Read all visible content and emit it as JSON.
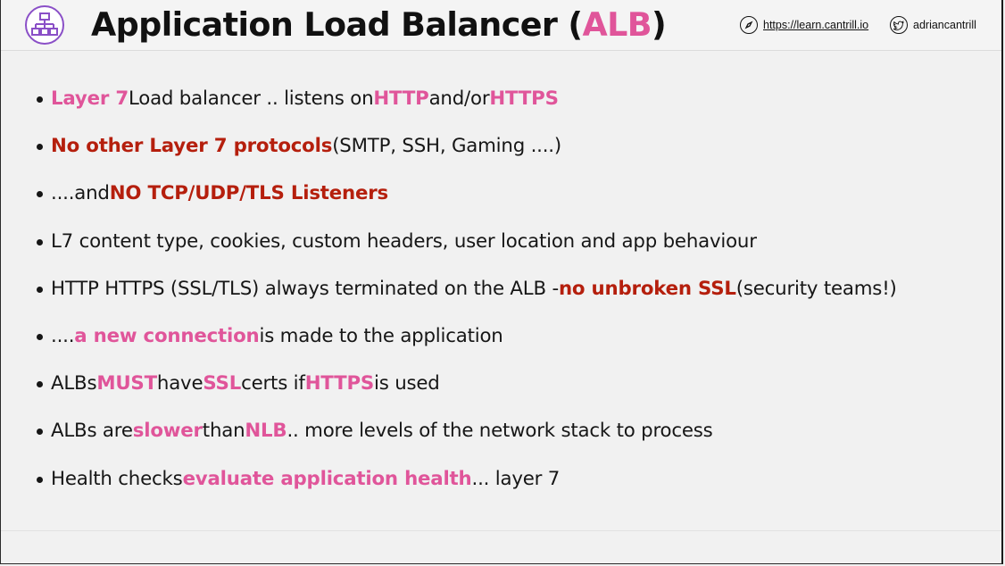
{
  "header": {
    "title_main": "Application Load Balancer (",
    "title_accent": "ALB",
    "title_end": ")",
    "website": "https://learn.cantrill.io",
    "twitter": "adriancantrill",
    "accent_pink": "#e0559a",
    "accent_red": "#b51f0d",
    "logo_icon": "network-hierarchy-icon",
    "website_icon": "compass-icon",
    "twitter_icon": "twitter-bird-icon"
  },
  "bullets": [
    [
      {
        "t": "Layer 7",
        "s": "pink"
      },
      {
        "t": " Load balancer .. listens on ",
        "s": ""
      },
      {
        "t": "HTTP",
        "s": "pink"
      },
      {
        "t": " and/or ",
        "s": ""
      },
      {
        "t": "HTTPS",
        "s": "pink"
      }
    ],
    [
      {
        "t": "No other Layer 7 protocols",
        "s": "red"
      },
      {
        "t": " (SMTP, SSH, Gaming ....)",
        "s": ""
      }
    ],
    [
      {
        "t": "....and ",
        "s": ""
      },
      {
        "t": "NO TCP/UDP/TLS Listeners",
        "s": "red"
      }
    ],
    [
      {
        "t": "L7 content type, cookies, custom headers, user location and app behaviour",
        "s": ""
      }
    ],
    [
      {
        "t": "HTTP HTTPS (SSL/TLS) always terminated on the ALB - ",
        "s": ""
      },
      {
        "t": "no unbroken SSL",
        "s": "red"
      },
      {
        "t": " (security teams!)",
        "s": ""
      }
    ],
    [
      {
        "t": "....",
        "s": ""
      },
      {
        "t": "a new connection",
        "s": "pink"
      },
      {
        "t": " is made to the application",
        "s": ""
      }
    ],
    [
      {
        "t": "ALBs ",
        "s": ""
      },
      {
        "t": "MUST",
        "s": "pink"
      },
      {
        "t": " have ",
        "s": ""
      },
      {
        "t": "SSL",
        "s": "pink"
      },
      {
        "t": " certs if ",
        "s": ""
      },
      {
        "t": "HTTPS",
        "s": "pink"
      },
      {
        "t": " is used",
        "s": ""
      }
    ],
    [
      {
        "t": "ALBs are ",
        "s": ""
      },
      {
        "t": "slower",
        "s": "pink"
      },
      {
        "t": " than ",
        "s": ""
      },
      {
        "t": "NLB",
        "s": "pink"
      },
      {
        "t": " .. more levels of the network stack to process",
        "s": ""
      }
    ],
    [
      {
        "t": "Health checks ",
        "s": ""
      },
      {
        "t": "evaluate application health",
        "s": "pink"
      },
      {
        "t": " ... layer 7",
        "s": ""
      }
    ]
  ]
}
